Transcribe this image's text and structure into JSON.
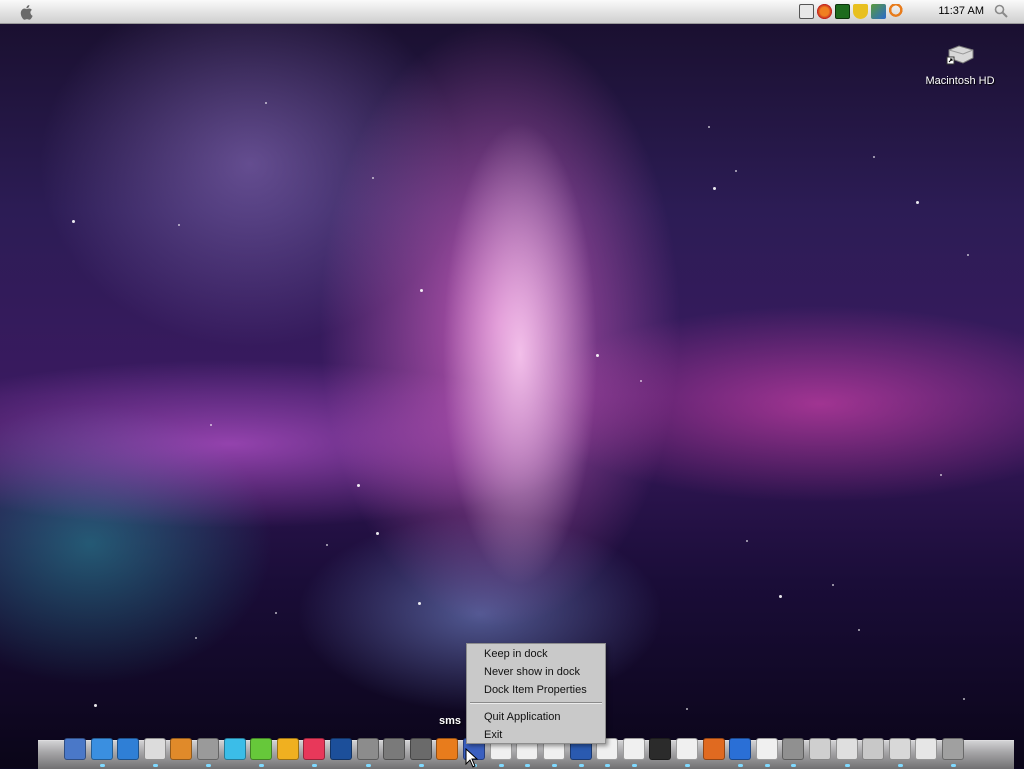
{
  "menubar": {
    "apple_icon": "apple-icon",
    "clock": "11:37 AM",
    "tray_icons": [
      "keyboard-icon",
      "butterfly-icon",
      "green-board-icon",
      "shield-icon",
      "network-icon",
      "search-tray-icon"
    ],
    "spotlight_icon": "spotlight-icon"
  },
  "desktop": {
    "hd_label": "Macintosh HD"
  },
  "context_menu": {
    "items": [
      "Keep in dock",
      "Never show in dock",
      "Dock Item Properties",
      "Quit Application",
      "Exit"
    ]
  },
  "dock": {
    "tooltip": "sms",
    "items": [
      {
        "name": "finder-icon",
        "color": "#4a78c8"
      },
      {
        "name": "safari-icon",
        "color": "#3a8fe0"
      },
      {
        "name": "quicktime-icon",
        "color": "#2f7fd6"
      },
      {
        "name": "textedit-icon",
        "color": "#dcdcdc"
      },
      {
        "name": "app-a-icon",
        "color": "#e08a2a"
      },
      {
        "name": "calculator-icon",
        "color": "#9a9a9a"
      },
      {
        "name": "app-u-icon",
        "color": "#3bbde8"
      },
      {
        "name": "app-x-icon",
        "color": "#66c83a"
      },
      {
        "name": "app-p-icon",
        "color": "#f0b020"
      },
      {
        "name": "app-n-icon",
        "color": "#e8385a"
      },
      {
        "name": "photoshop-icon",
        "color": "#1c4f9a"
      },
      {
        "name": "system-preferences-icon",
        "color": "#8c8c8c"
      },
      {
        "name": "utility-icon",
        "color": "#7a7a7a"
      },
      {
        "name": "shutdown-icon",
        "color": "#6a6a6a"
      },
      {
        "name": "search-app-icon",
        "color": "#e87c1c"
      },
      {
        "name": "sms-icon",
        "color": "#3a5fc0"
      },
      {
        "name": "window-1-icon",
        "color": "#f0f0f0"
      },
      {
        "name": "window-2-icon",
        "color": "#f0f0f0"
      },
      {
        "name": "window-3-icon",
        "color": "#f0f0f0"
      },
      {
        "name": "window-4-icon",
        "color": "#2a5ab0"
      },
      {
        "name": "window-5-icon",
        "color": "#f0f0f0"
      },
      {
        "name": "window-6-icon",
        "color": "#f0f0f0"
      },
      {
        "name": "monitor-icon",
        "color": "#2b2b2b"
      },
      {
        "name": "window-7-icon",
        "color": "#f0f0f0"
      },
      {
        "name": "butterfly-app-icon",
        "color": "#e06a20"
      },
      {
        "name": "help-icon",
        "color": "#2a6fd6"
      },
      {
        "name": "window-8-icon",
        "color": "#f0f0f0"
      },
      {
        "name": "doc-icon",
        "color": "#909090"
      },
      {
        "name": "doc-2-icon",
        "color": "#cfcfcf"
      },
      {
        "name": "doc-3-icon",
        "color": "#dfdfdf"
      },
      {
        "name": "doc-4-icon",
        "color": "#c8c8c8"
      },
      {
        "name": "doc-5-icon",
        "color": "#d8d8d8"
      },
      {
        "name": "doc-6-icon",
        "color": "#e6e6e6"
      },
      {
        "name": "trash-icon",
        "color": "#a0a0a0"
      }
    ]
  }
}
